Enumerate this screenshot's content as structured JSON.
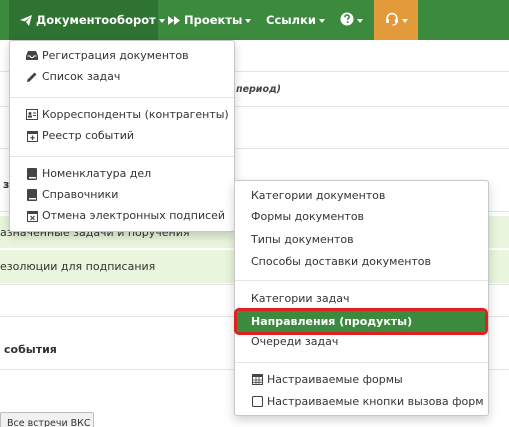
{
  "navbar": {
    "documents_label": "Документооборот",
    "projects_label": "Проекты",
    "links_label": "Ссылки"
  },
  "background": {
    "period_hint": "период)",
    "letter_z": "з",
    "tasks_row": "азначенные задачи и поручения",
    "resolutions_row": "езолюции для подписания",
    "events_header": "события",
    "vks_button": "Все встречи ВКС"
  },
  "documents_menu": {
    "items": [
      {
        "label": "Регистрация документов",
        "icon": "inbox-icon"
      },
      {
        "label": "Список задач",
        "icon": "pencil-icon"
      },
      {
        "label": "Корреспонденты (контрагенты)",
        "icon": "id-card-icon"
      },
      {
        "label": "Реестр событий",
        "icon": "calendar-plus-icon"
      },
      {
        "label": "Номенклатура дел",
        "icon": "book-icon"
      },
      {
        "label": "Справочники",
        "icon": "book-icon"
      },
      {
        "label": "Отмена электронных подписей",
        "icon": "calendar-times-icon"
      }
    ]
  },
  "links_menu": {
    "items": [
      {
        "label": "Категории документов"
      },
      {
        "label": "Формы документов"
      },
      {
        "label": "Типы документов"
      },
      {
        "label": "Способы доставки документов"
      },
      {
        "label": "Категории задач"
      },
      {
        "label": "Направления (продукты)"
      },
      {
        "label": "Очереди задач"
      },
      {
        "label": "Настраиваемые формы",
        "icon": "table-icon"
      },
      {
        "label": "Настраиваемые кнопки вызова форм",
        "icon": "checkbox-icon"
      }
    ]
  },
  "colors": {
    "navbar": "#3c8a3e",
    "navbar_active": "#2f7332",
    "support_button": "#e39a3b",
    "highlight": "#3c8a3e",
    "highlight_border": "#e02020",
    "green_row": "#e9f5dc"
  }
}
